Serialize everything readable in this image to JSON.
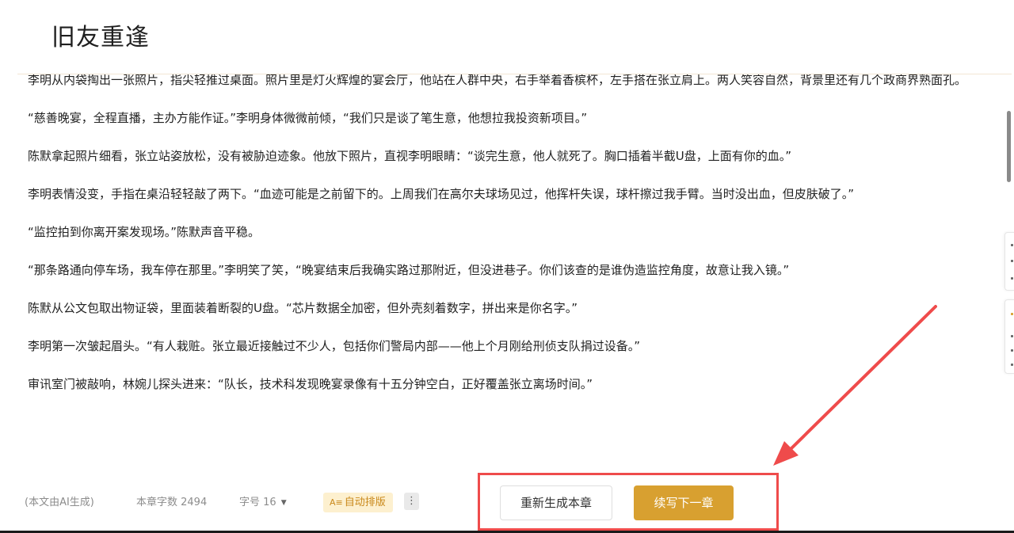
{
  "header": {
    "title": "旧友重逢"
  },
  "content": {
    "paragraphs": [
      "李明从内袋掏出一张照片，指尖轻推过桌面。照片里是灯火辉煌的宴会厅，他站在人群中央，右手举着香槟杯，左手搭在张立肩上。两人笑容自然，背景里还有几个政商界熟面孔。",
      "“慈善晚宴，全程直播，主办方能作证。”李明身体微微前倾，“我们只是谈了笔生意，他想拉我投资新项目。”",
      "陈默拿起照片细看，张立站姿放松，没有被胁迫迹象。他放下照片，直视李明眼睛：“谈完生意，他人就死了。胸口插着半截U盘，上面有你的血。”",
      "李明表情没变，手指在桌沿轻轻敲了两下。“血迹可能是之前留下的。上周我们在高尔夫球场见过，他挥杆失误，球杆擦过我手臂。当时没出血，但皮肤破了。”",
      "“监控拍到你离开案发现场。”陈默声音平稳。",
      "“那条路通向停车场，我车停在那里。”李明笑了笑，“晚宴结束后我确实路过那附近，但没进巷子。你们该查的是谁伪造监控角度，故意让我入镜。”",
      "陈默从公文包取出物证袋，里面装着断裂的U盘。“芯片数据全加密，但外壳刻着数字，拼出来是你名字。”",
      "李明第一次皱起眉头。“有人栽赃。张立最近接触过不少人，包括你们警局内部——他上个月刚给刑侦支队捐过设备。”",
      "审讯室门被敲响，林婉儿探头进来：“队长，技术科发现晚宴录像有十五分钟空白，正好覆盖张立离场时间。”"
    ]
  },
  "footer": {
    "ai_note": "(本文由AI生成)",
    "word_count": "本章字数 2494",
    "font_size": "字号 16",
    "auto_layout_icon": "A≡",
    "auto_layout": "自动排版",
    "more_icon": "⋮",
    "regenerate": "重新生成本章",
    "continue": "续写下一章"
  },
  "colors": {
    "accent": "#d8a030",
    "annotation": "#ef4b4b",
    "auto_layout_bg": "#fdf0cf"
  }
}
